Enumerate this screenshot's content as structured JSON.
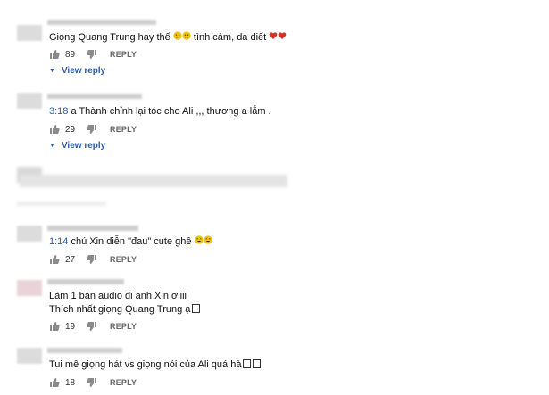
{
  "comments": [
    {
      "text": "Giọng Quang Trung hay thế",
      "text_tail": "tình cảm, da diết",
      "likes": "89",
      "reply_label": "REPLY",
      "view_reply": "View reply"
    },
    {
      "timestamp": "3:18",
      "text": "a Thành chỉnh lại tóc cho Ali ,,, thương a lắm .",
      "likes": "29",
      "reply_label": "REPLY",
      "view_reply": "View reply"
    },
    {
      "timestamp": "1:14",
      "text": "chú Xin diễn \"đau\" cute ghê",
      "likes": "27",
      "reply_label": "REPLY"
    },
    {
      "line1": "Làm 1 bản audio đi anh Xin ơiiii",
      "line2": "Thích nhất giọng Quang Trung ạ",
      "likes": "19",
      "reply_label": "REPLY"
    },
    {
      "text": "Tui mê giọng hát vs giọng nói của Ali quá hà",
      "likes": "18",
      "reply_label": "REPLY"
    }
  ],
  "icons": {
    "like": "thumb-up-icon",
    "dislike": "thumb-down-icon",
    "expand": "caret-down-icon",
    "emoji_cry": "crying-face-icon",
    "emoji_heart": "heart-icon",
    "emoji_laugh": "laughing-face-icon"
  },
  "colors": {
    "link": "#2a5ba8",
    "heart": "#d93025",
    "emoji_face": "#f2c200"
  }
}
